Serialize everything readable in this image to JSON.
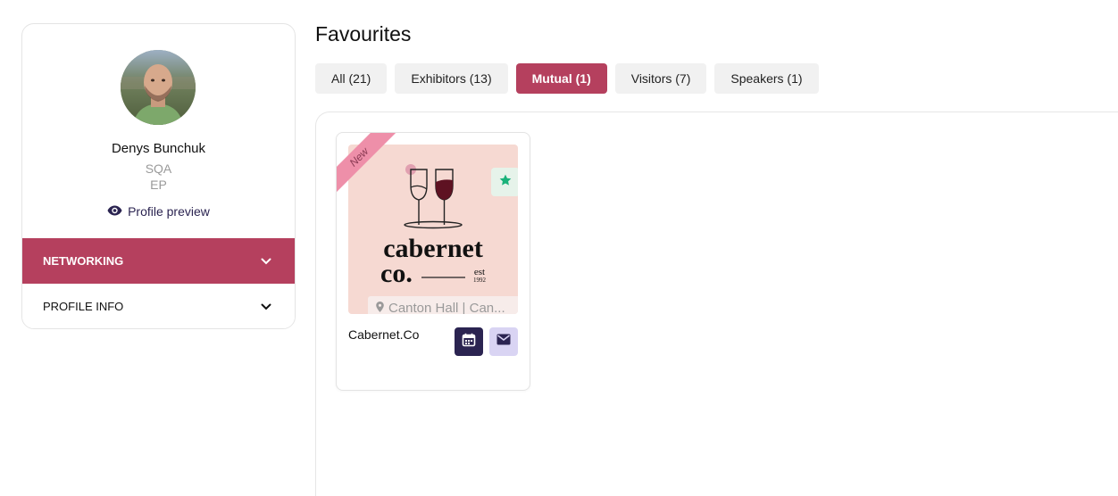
{
  "profile": {
    "name": "Denys Bunchuk",
    "role": "SQA",
    "org": "EP",
    "preview_label": "Profile preview"
  },
  "menu": {
    "networking_label": "NETWORKING",
    "profile_info_label": "PROFILE INFO"
  },
  "main": {
    "title": "Favourites",
    "tabs": [
      {
        "label": "All (21)",
        "active": false
      },
      {
        "label": "Exhibitors (13)",
        "active": false
      },
      {
        "label": "Mutual (1)",
        "active": true
      },
      {
        "label": "Visitors (7)",
        "active": false
      },
      {
        "label": "Speakers (1)",
        "active": false
      }
    ]
  },
  "card": {
    "ribbon": "New",
    "logo_line1": "cabernet",
    "logo_line2": "co.",
    "logo_est": "est",
    "logo_year": "1992",
    "location": "Canton Hall | Can...",
    "name": "Cabernet.Co"
  },
  "colors": {
    "accent": "#b5405e",
    "navy": "#2b2451",
    "card_bg": "#f6d9d2",
    "star": "#19b27a"
  },
  "icons": [
    "eye-icon",
    "chevron-down-icon",
    "star-icon",
    "location-pin-icon",
    "calendar-icon",
    "mail-icon"
  ]
}
